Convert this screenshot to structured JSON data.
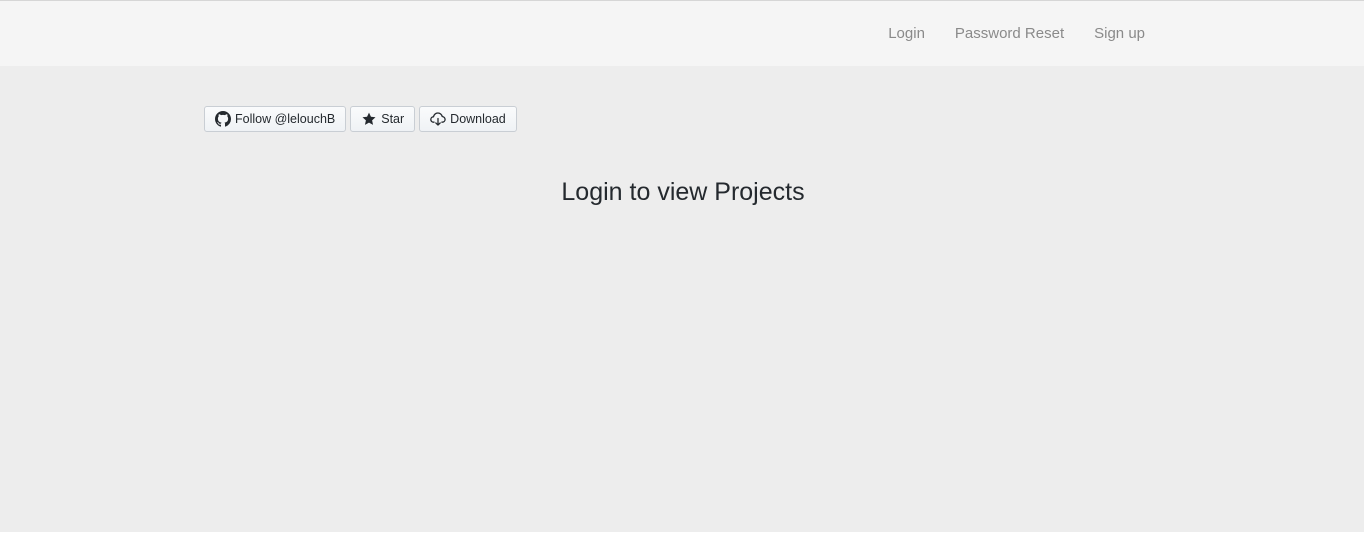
{
  "navbar": {
    "links": [
      {
        "label": "Login"
      },
      {
        "label": "Password Reset"
      },
      {
        "label": "Sign up"
      }
    ]
  },
  "buttons": {
    "follow": {
      "label": "Follow @lelouchB",
      "icon": "github-icon"
    },
    "star": {
      "label": "Star",
      "icon": "star-icon"
    },
    "download": {
      "label": "Download",
      "icon": "cloud-download-icon"
    }
  },
  "main": {
    "heading": "Login to view Projects"
  },
  "colors": {
    "background": "#ededed",
    "navbar_background": "#f5f5f5",
    "nav_link": "#8a8a8a",
    "heading": "#24292e"
  }
}
